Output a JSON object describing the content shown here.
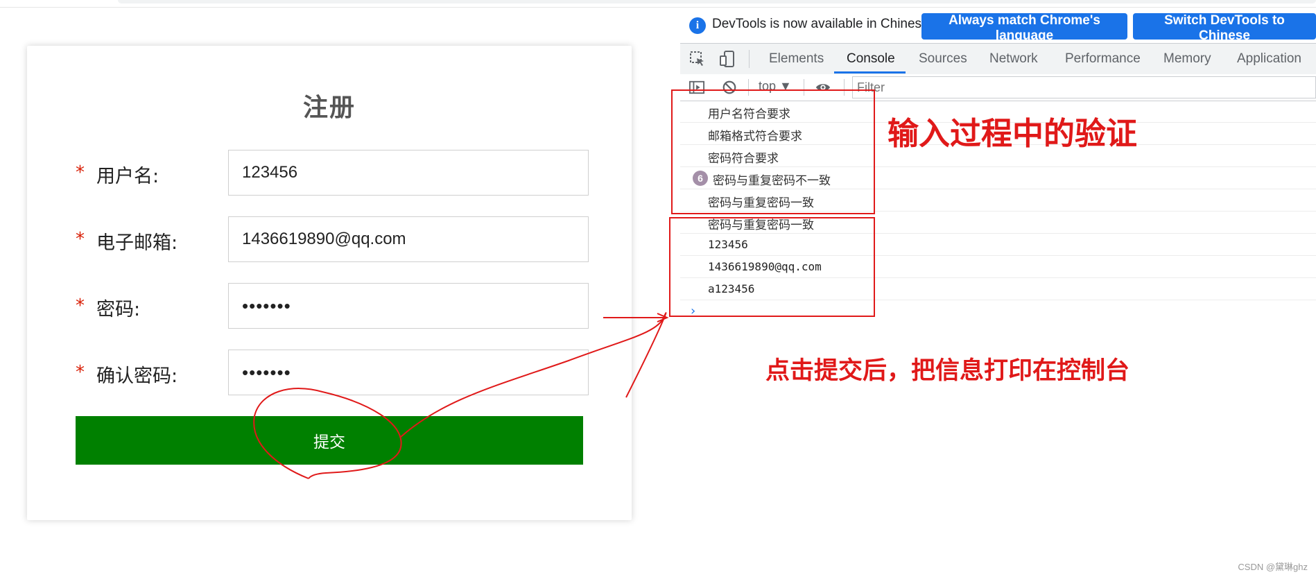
{
  "form": {
    "title": "注册",
    "required_mark": "*",
    "fields": [
      {
        "label": "用户名:",
        "value": "123456",
        "type": "text"
      },
      {
        "label": "电子邮箱:",
        "value": "1436619890@qq.com",
        "type": "text"
      },
      {
        "label": "密码:",
        "value": "•••••••",
        "type": "password"
      },
      {
        "label": "确认密码:",
        "value": "•••••••",
        "type": "password"
      }
    ],
    "submit_label": "提交",
    "submit_color": "#008000",
    "required_color": "#d81e06"
  },
  "devtools": {
    "info_icon": "info-icon",
    "info_glyph": "i",
    "info_text": "DevTools is now available in Chinese!",
    "buttons": [
      "Always match Chrome's language",
      "Switch DevTools to Chinese"
    ],
    "tabs": [
      "Elements",
      "Console",
      "Sources",
      "Network",
      "Performance",
      "Memory",
      "Application"
    ],
    "active_tab": "Console",
    "context": "top ▼",
    "filter_placeholder": "Filter",
    "accent": "#1a73e8",
    "console": [
      {
        "text": "用户名符合要求"
      },
      {
        "text": "邮箱格式符合要求"
      },
      {
        "text": "密码符合要求"
      },
      {
        "text": "密码与重复密码不一致",
        "count": "6"
      },
      {
        "text": "密码与重复密码一致"
      },
      {
        "text": "密码与重复密码一致"
      },
      {
        "text": "123456"
      },
      {
        "text": "1436619890@qq.com"
      },
      {
        "text": "a123456"
      }
    ],
    "prompt": "›"
  },
  "annotations": {
    "validation_note": "输入过程中的验证",
    "submit_note": "点击提交后，把信息打印在控制台",
    "color": "#e01919"
  },
  "watermark": "CSDN @黛琳ghz"
}
